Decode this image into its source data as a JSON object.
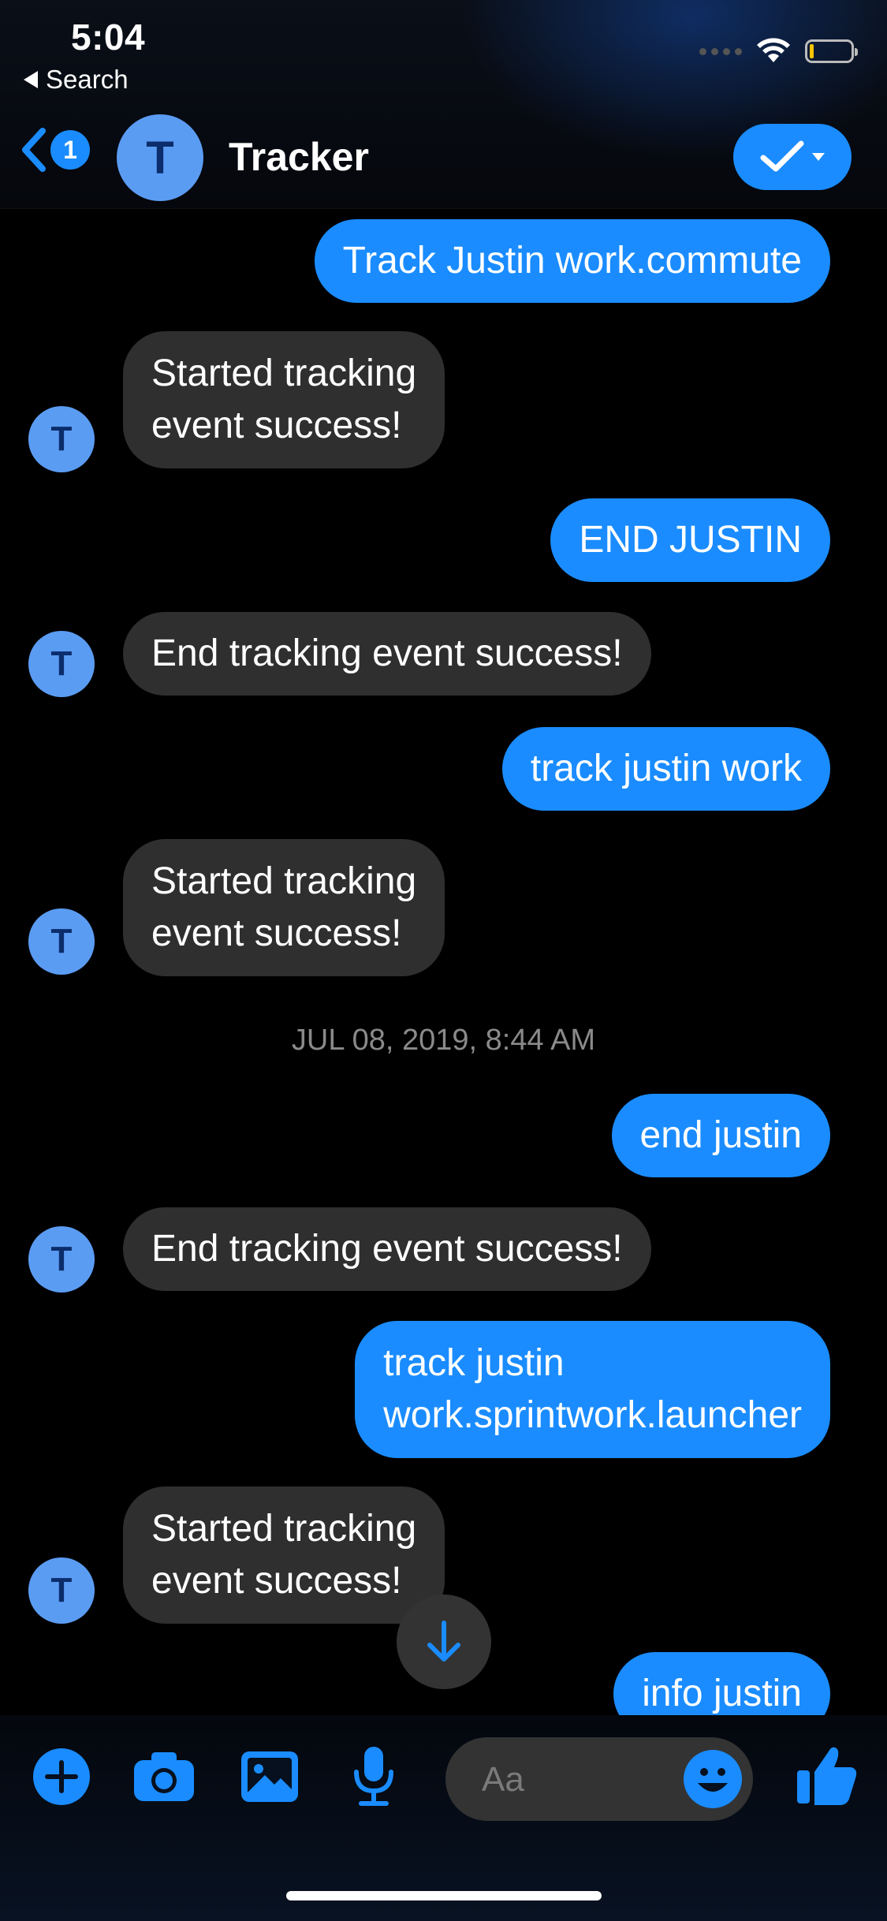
{
  "status_bar": {
    "time": "5:04",
    "back_label": "Search"
  },
  "header": {
    "unread_count": "1",
    "avatar_initial": "T",
    "title": "Tracker"
  },
  "messages": [
    {
      "direction": "out",
      "text": "Track Justin work.commute"
    },
    {
      "direction": "in",
      "text": "Started tracking\nevent success!"
    },
    {
      "direction": "out",
      "text": "END JUSTIN"
    },
    {
      "direction": "in",
      "text": "End tracking event success!"
    },
    {
      "direction": "out",
      "text": "track justin work"
    },
    {
      "direction": "in",
      "text": "Started tracking\nevent success!"
    },
    {
      "direction": "out",
      "text": "end justin"
    },
    {
      "direction": "in",
      "text": "End tracking event success!"
    },
    {
      "direction": "out",
      "text": "track justin\nwork.sprintwork.launcher"
    },
    {
      "direction": "in",
      "text": "Started tracking\nevent success!"
    },
    {
      "direction": "out",
      "text": "info justin"
    }
  ],
  "bot_avatar_initial": "T",
  "timestamp": "JUL 08, 2019, 8:44 AM",
  "composer": {
    "placeholder": "Aa"
  },
  "colors": {
    "accent": "#1a8cff",
    "incoming_bubble": "#2f2f2f",
    "avatar": "#5b9cf3"
  },
  "icons": [
    "chevron-left-icon",
    "checkmark-icon",
    "arrow-down-icon",
    "plus-icon",
    "camera-icon",
    "image-icon",
    "microphone-icon",
    "emoji-icon",
    "thumbs-up-icon",
    "wifi-icon",
    "battery-icon"
  ]
}
